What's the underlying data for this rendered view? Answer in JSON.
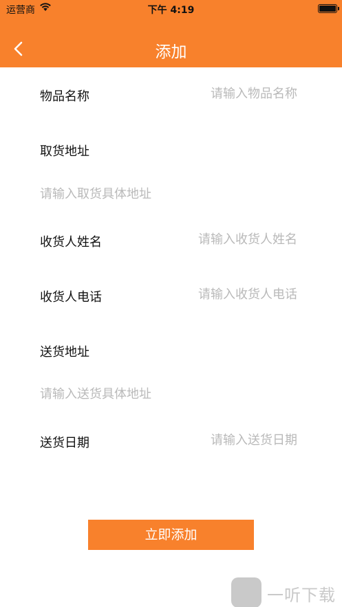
{
  "status_bar": {
    "carrier": "运营商",
    "time": "下午 4:19"
  },
  "nav": {
    "title": "添加"
  },
  "form": {
    "item_name": {
      "label": "物品名称",
      "placeholder": "请输入物品名称"
    },
    "pickup_address": {
      "label": "取货地址",
      "placeholder": "请输入取货具体地址"
    },
    "receiver_name": {
      "label": "收货人姓名",
      "placeholder": "请输入收货人姓名"
    },
    "receiver_phone": {
      "label": "收货人电话",
      "placeholder": "请输入收货人电话"
    },
    "delivery_address": {
      "label": "送货地址",
      "placeholder": "请输入送货具体地址"
    },
    "delivery_date": {
      "label": "送货日期",
      "placeholder": "请输入送货日期"
    }
  },
  "submit_label": "立即添加",
  "watermark": {
    "text": "一听下载"
  },
  "colors": {
    "accent": "#f8812c",
    "placeholder": "#b9b9b9",
    "text": "#111111"
  }
}
